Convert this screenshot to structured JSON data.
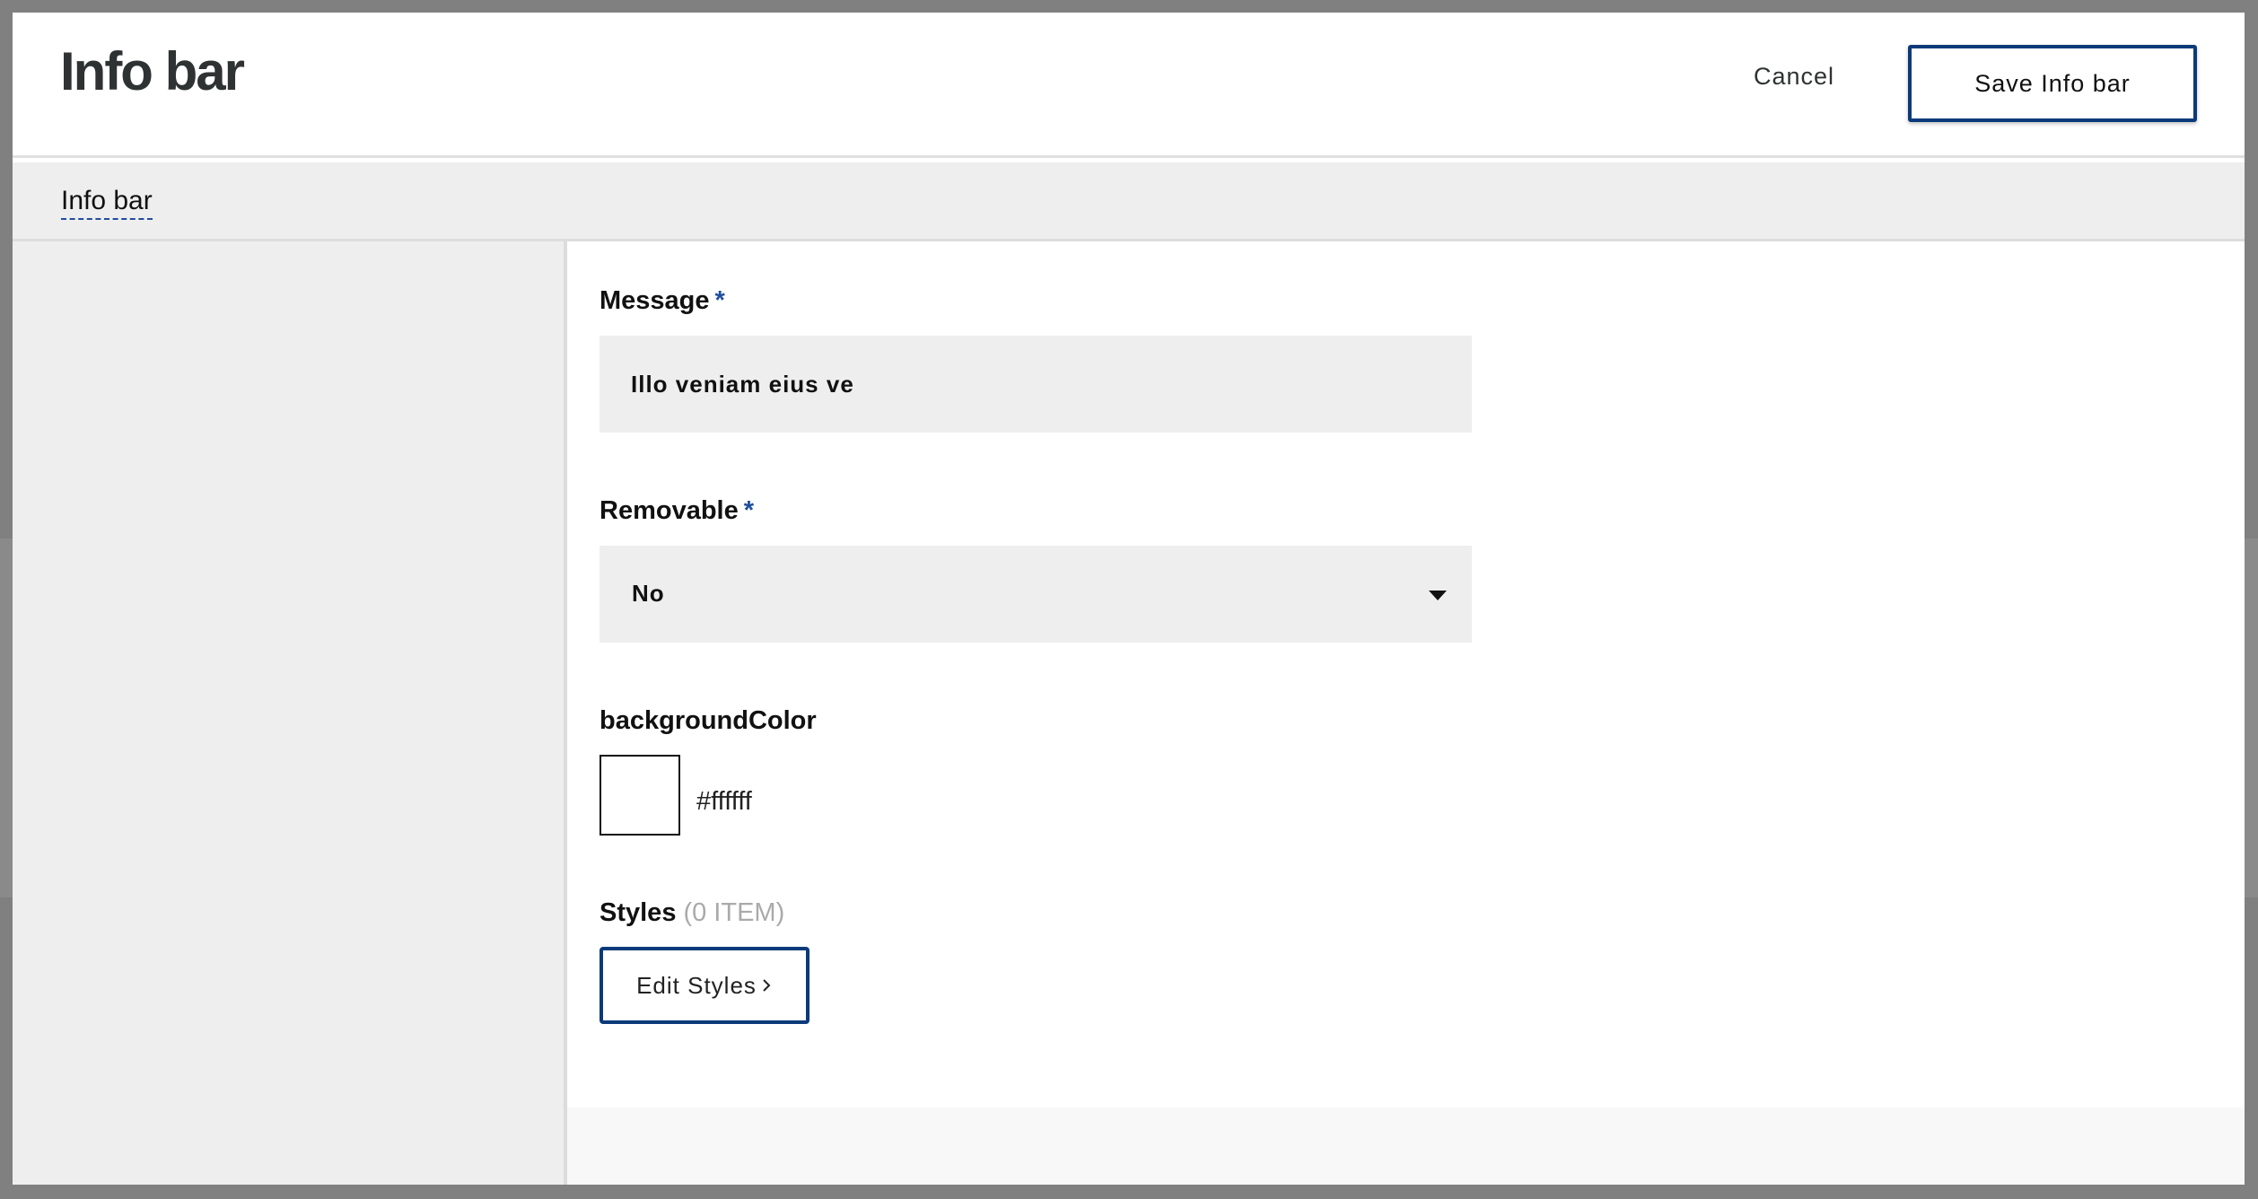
{
  "modal": {
    "title": "Info bar",
    "cancel_label": "Cancel",
    "save_label": "Save Info bar"
  },
  "tabs": [
    {
      "label": "Info bar",
      "active": true
    }
  ],
  "fields": {
    "message": {
      "label": "Message",
      "required_marker": "*",
      "value": "Illo veniam eius ve"
    },
    "removable": {
      "label": "Removable",
      "required_marker": "*",
      "value": "No",
      "icon": "caret-down-icon"
    },
    "background_color": {
      "label": "backgroundColor",
      "value": "#ffffff"
    },
    "styles": {
      "label": "Styles",
      "count_text": "(0 ITEM)",
      "edit_label": "Edit Styles",
      "edit_icon": "chevron-right-icon"
    }
  },
  "colors": {
    "accent": "#0b3a7a",
    "required": "#1f4d9c",
    "panel_bg": "#eeeeee",
    "overlay": "#808080"
  }
}
